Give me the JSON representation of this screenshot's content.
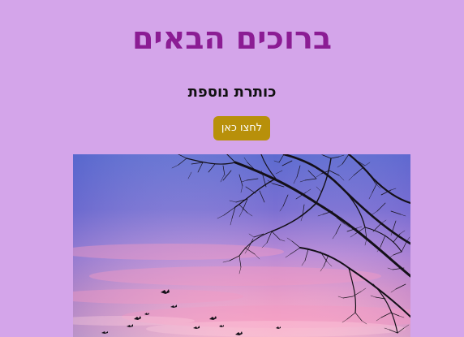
{
  "page": {
    "title": "ברוכים הבאים",
    "subtitle": "כותרת נוספת",
    "button_label": "לחצו כאן"
  },
  "colors": {
    "background": "#d4a5ea",
    "title": "#8b1c94",
    "button": "#b8900a"
  },
  "hero": {
    "icon": "sunset-tree-branches-birds-photo"
  }
}
